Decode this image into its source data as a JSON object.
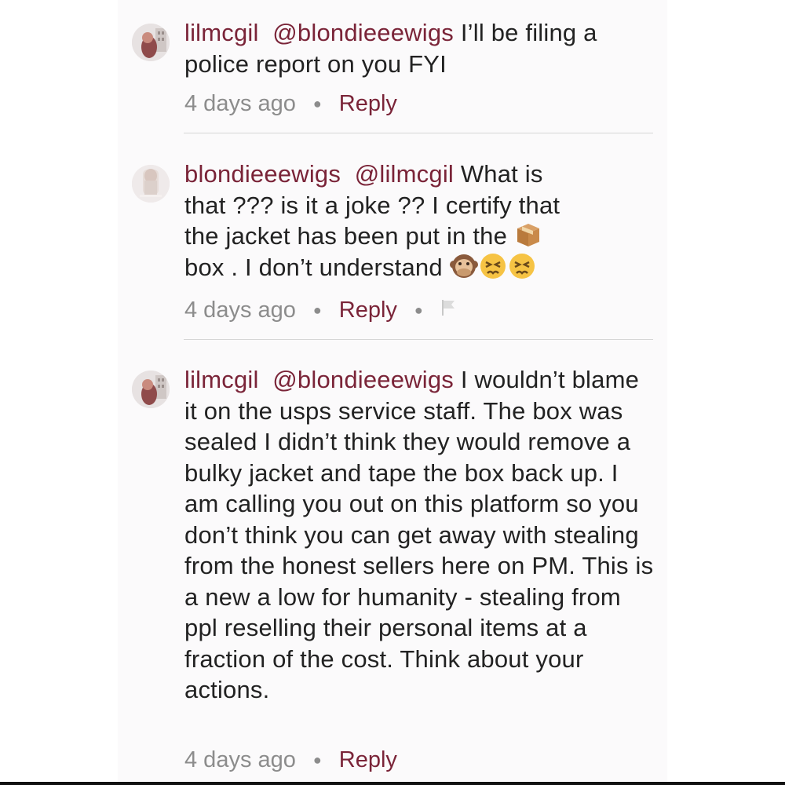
{
  "comments": [
    {
      "username": "lilmcgil",
      "mention": "@blondieeewigs",
      "text": "I’ll be filing a police report on you FYI",
      "time": "4 days ago",
      "reply": "Reply"
    },
    {
      "username": "blondieeewigs",
      "mention": "@lilmcgil",
      "text_line1": "What is",
      "text_line2": "that ???  is it a joke ??  I certify that",
      "text_line3": "the jacket has been put in the",
      "text_line4": "box . I don’t understand",
      "time": "4 days ago",
      "reply": "Reply",
      "emojis": [
        "package-emoji",
        "speak-no-evil-monkey-emoji",
        "persevering-face-emoji",
        "persevering-face-emoji"
      ]
    },
    {
      "username": "lilmcgil",
      "mention": "@blondieeewigs",
      "text": "I wouldn’t blame it on the usps service staff. The box was sealed I didn’t think they would remove a bulky jacket and tape the box back up. I am calling you out on this platform so you don’t think you can get away with stealing from the honest sellers here on PM. This is a new a low for humanity - stealing from ppl reselling their personal items at a fraction of the cost. Think about your actions.",
      "time": "4 days ago",
      "reply": "Reply"
    }
  ],
  "colors": {
    "accent": "#7a2438",
    "meta": "#8c8c8c",
    "text": "#222222",
    "divider": "#d6d6d6"
  }
}
